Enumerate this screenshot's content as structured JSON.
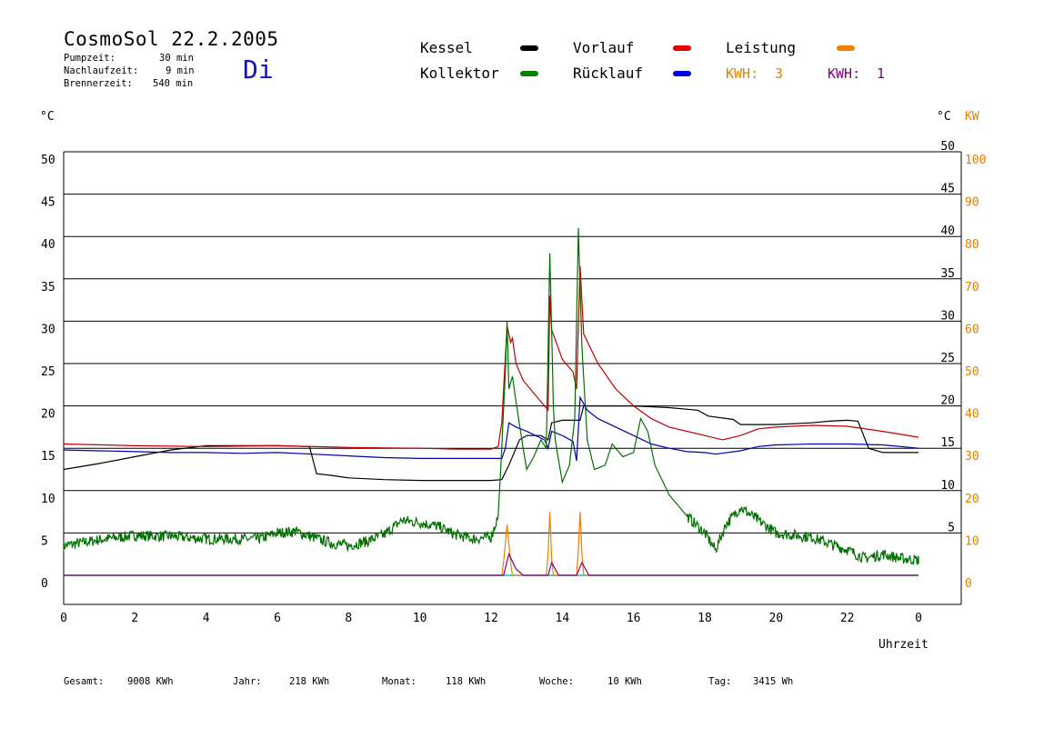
{
  "header": {
    "title": "CosmoSol 22.2.2005",
    "day": "Di",
    "info": [
      {
        "label": "Pumpzeit:",
        "value": "30 min"
      },
      {
        "label": "Nachlaufzeit:",
        "value": "9 min"
      },
      {
        "label": "Brennerzeit:",
        "value": "540 min"
      }
    ]
  },
  "legend": {
    "kessel": {
      "label": "Kessel",
      "color": "#000000"
    },
    "kollektor": {
      "label": "Kollektor",
      "color": "#008000"
    },
    "vorlauf": {
      "label": "Vorlauf",
      "color": "#e00000"
    },
    "ruecklauf": {
      "label": "Rücklauf",
      "color": "#0000e0"
    },
    "leistung": {
      "label": "Leistung",
      "color": "#f08000"
    },
    "kwh1": {
      "label": "KWH:",
      "value": "3",
      "color": "#e08000"
    },
    "kwh2": {
      "label": "KWH:",
      "value": "1",
      "color": "#800080"
    }
  },
  "footer": [
    {
      "label": "Gesamt:",
      "value": "9008 KWh"
    },
    {
      "label": "Jahr:",
      "value": "218 KWh"
    },
    {
      "label": "Monat:",
      "value": "118 KWh"
    },
    {
      "label": "Woche:",
      "value": "10 KWh"
    },
    {
      "label": "Tag:",
      "value": "3415 Wh"
    }
  ],
  "chart_data": {
    "type": "line",
    "xlabel": "Uhrzeit",
    "x_ticks": [
      "0",
      "2",
      "4",
      "6",
      "8",
      "10",
      "12",
      "14",
      "16",
      "18",
      "20",
      "22",
      "0"
    ],
    "xlim": [
      0,
      24
    ],
    "y_left": {
      "unit": "°C",
      "range": [
        0,
        50
      ],
      "ticks": [
        "0",
        "5",
        "10",
        "15",
        "20",
        "25",
        "30",
        "35",
        "40",
        "45",
        "50"
      ]
    },
    "y_right_temp": {
      "unit": "°C",
      "range": [
        0,
        50
      ],
      "ticks": [
        "5",
        "10",
        "15",
        "20",
        "25",
        "30",
        "35",
        "40",
        "45",
        "50"
      ]
    },
    "y_right_power": {
      "unit": "KW",
      "range": [
        0,
        100
      ],
      "ticks": [
        "0",
        "10",
        "20",
        "30",
        "40",
        "50",
        "60",
        "70",
        "80",
        "90",
        "100"
      ]
    },
    "grid": true,
    "series": [
      {
        "name": "Kessel",
        "key": "kessel",
        "axis": "temp",
        "color": "#000000",
        "points": [
          [
            0,
            12.5
          ],
          [
            1,
            13.2
          ],
          [
            2,
            14.0
          ],
          [
            3,
            14.8
          ],
          [
            4,
            15.3
          ],
          [
            5,
            15.3
          ],
          [
            6,
            15.3
          ],
          [
            6.9,
            15.2
          ],
          [
            7.1,
            12.0
          ],
          [
            7.5,
            11.8
          ],
          [
            8,
            11.5
          ],
          [
            9,
            11.3
          ],
          [
            10,
            11.2
          ],
          [
            11,
            11.2
          ],
          [
            12,
            11.2
          ],
          [
            12.3,
            11.3
          ],
          [
            12.5,
            13.0
          ],
          [
            12.8,
            16.0
          ],
          [
            13.0,
            16.5
          ],
          [
            13.4,
            16.5
          ],
          [
            13.6,
            16.0
          ],
          [
            13.7,
            18.0
          ],
          [
            14.0,
            18.3
          ],
          [
            14.5,
            18.3
          ],
          [
            14.6,
            20.0
          ],
          [
            15,
            20.0
          ],
          [
            16,
            20.0
          ],
          [
            17,
            19.8
          ],
          [
            17.8,
            19.5
          ],
          [
            18.1,
            18.8
          ],
          [
            18.8,
            18.4
          ],
          [
            19,
            17.8
          ],
          [
            20,
            17.8
          ],
          [
            21,
            18.0
          ],
          [
            21.5,
            18.2
          ],
          [
            22,
            18.3
          ],
          [
            22.3,
            18.2
          ],
          [
            22.6,
            15.0
          ],
          [
            23,
            14.5
          ],
          [
            24,
            14.5
          ]
        ]
      },
      {
        "name": "Vorlauf",
        "key": "vorlauf",
        "axis": "temp",
        "color": "#c00000",
        "points": [
          [
            0,
            15.5
          ],
          [
            2,
            15.3
          ],
          [
            4,
            15.2
          ],
          [
            6,
            15.3
          ],
          [
            8,
            15.1
          ],
          [
            10,
            15.0
          ],
          [
            11,
            14.9
          ],
          [
            12,
            14.9
          ],
          [
            12.2,
            15.2
          ],
          [
            12.3,
            18.0
          ],
          [
            12.45,
            29.5
          ],
          [
            12.55,
            27.5
          ],
          [
            12.6,
            28.0
          ],
          [
            12.7,
            25.0
          ],
          [
            12.9,
            23.0
          ],
          [
            13.2,
            21.5
          ],
          [
            13.6,
            19.5
          ],
          [
            13.65,
            33.0
          ],
          [
            13.7,
            29.0
          ],
          [
            14.0,
            25.5
          ],
          [
            14.3,
            24.0
          ],
          [
            14.4,
            22.0
          ],
          [
            14.5,
            36.5
          ],
          [
            14.6,
            28.5
          ],
          [
            15,
            25.0
          ],
          [
            15.5,
            22.0
          ],
          [
            16,
            20.0
          ],
          [
            16.5,
            18.5
          ],
          [
            17,
            17.5
          ],
          [
            18,
            16.5
          ],
          [
            18.5,
            16.0
          ],
          [
            19,
            16.5
          ],
          [
            19.5,
            17.3
          ],
          [
            20,
            17.5
          ],
          [
            21,
            17.7
          ],
          [
            22,
            17.6
          ],
          [
            23,
            17.0
          ],
          [
            24,
            16.3
          ]
        ]
      },
      {
        "name": "Rücklauf",
        "key": "ruecklauf",
        "axis": "temp",
        "color": "#0000b0",
        "points": [
          [
            0,
            14.8
          ],
          [
            1,
            14.7
          ],
          [
            2,
            14.6
          ],
          [
            3,
            14.5
          ],
          [
            4,
            14.5
          ],
          [
            5,
            14.4
          ],
          [
            6,
            14.5
          ],
          [
            7,
            14.3
          ],
          [
            8,
            14.1
          ],
          [
            9,
            13.9
          ],
          [
            10,
            13.8
          ],
          [
            11,
            13.8
          ],
          [
            12,
            13.8
          ],
          [
            12.3,
            13.8
          ],
          [
            12.4,
            15.0
          ],
          [
            12.5,
            18.0
          ],
          [
            12.7,
            17.5
          ],
          [
            13,
            17.0
          ],
          [
            13.5,
            16.0
          ],
          [
            13.6,
            15.0
          ],
          [
            13.7,
            17.0
          ],
          [
            14,
            16.5
          ],
          [
            14.3,
            15.8
          ],
          [
            14.4,
            13.5
          ],
          [
            14.5,
            21.0
          ],
          [
            14.7,
            19.5
          ],
          [
            15,
            18.5
          ],
          [
            15.5,
            17.5
          ],
          [
            16,
            16.5
          ],
          [
            16.5,
            15.5
          ],
          [
            17,
            15.0
          ],
          [
            17.5,
            14.6
          ],
          [
            18,
            14.5
          ],
          [
            18.3,
            14.3
          ],
          [
            19,
            14.7
          ],
          [
            19.5,
            15.2
          ],
          [
            20,
            15.4
          ],
          [
            21,
            15.5
          ],
          [
            22,
            15.5
          ],
          [
            23,
            15.4
          ],
          [
            24,
            15.0
          ]
        ]
      },
      {
        "name": "Kollektor",
        "key": "kollektor",
        "axis": "temp",
        "color": "#007000",
        "points": [
          [
            0,
            3.5
          ],
          [
            1,
            4.2
          ],
          [
            2,
            4.7
          ],
          [
            3,
            4.6
          ],
          [
            4,
            4.3
          ],
          [
            5,
            4.3
          ],
          [
            5.5,
            4.3
          ],
          [
            6,
            5.0
          ],
          [
            6.5,
            5.2
          ],
          [
            7,
            4.5
          ],
          [
            7.5,
            3.8
          ],
          [
            8,
            3.5
          ],
          [
            8.5,
            4.0
          ],
          [
            9,
            4.8
          ],
          [
            9.5,
            6.5
          ],
          [
            10,
            6.2
          ],
          [
            10.5,
            5.8
          ],
          [
            11,
            4.8
          ],
          [
            11.5,
            4.3
          ],
          [
            12,
            4.5
          ],
          [
            12.2,
            7.0
          ],
          [
            12.3,
            15.0
          ],
          [
            12.4,
            24.0
          ],
          [
            12.45,
            30.0
          ],
          [
            12.5,
            22.0
          ],
          [
            12.6,
            23.5
          ],
          [
            12.7,
            20.5
          ],
          [
            12.9,
            15.0
          ],
          [
            13.0,
            12.5
          ],
          [
            13.2,
            14.0
          ],
          [
            13.4,
            16.0
          ],
          [
            13.55,
            15.0
          ],
          [
            13.65,
            38.0
          ],
          [
            13.75,
            20.0
          ],
          [
            13.8,
            16.0
          ],
          [
            14.0,
            11.0
          ],
          [
            14.2,
            13.0
          ],
          [
            14.35,
            18.5
          ],
          [
            14.45,
            41.0
          ],
          [
            14.55,
            27.0
          ],
          [
            14.7,
            16.0
          ],
          [
            14.9,
            12.5
          ],
          [
            15.2,
            13.0
          ],
          [
            15.4,
            15.5
          ],
          [
            15.7,
            14.0
          ],
          [
            16,
            14.5
          ],
          [
            16.2,
            18.5
          ],
          [
            16.4,
            17.0
          ],
          [
            16.6,
            13.0
          ],
          [
            17,
            9.5
          ],
          [
            17.5,
            7.0
          ],
          [
            18,
            5.0
          ],
          [
            18.3,
            3.0
          ],
          [
            18.6,
            6.0
          ],
          [
            19,
            8.0
          ],
          [
            19.5,
            6.5
          ],
          [
            20,
            5.0
          ],
          [
            21,
            4.5
          ],
          [
            22,
            3.0
          ],
          [
            22.5,
            2.0
          ],
          [
            23,
            2.5
          ],
          [
            23.5,
            2.0
          ],
          [
            24,
            1.8
          ]
        ]
      },
      {
        "name": "Leistung",
        "key": "leistung",
        "axis": "power",
        "color": "#f08000",
        "points": [
          [
            0,
            0
          ],
          [
            12.3,
            0
          ],
          [
            12.35,
            3
          ],
          [
            12.45,
            12
          ],
          [
            12.55,
            3
          ],
          [
            12.6,
            0
          ],
          [
            13.55,
            0
          ],
          [
            13.6,
            5
          ],
          [
            13.65,
            15
          ],
          [
            13.7,
            4
          ],
          [
            13.75,
            0
          ],
          [
            14.4,
            0
          ],
          [
            14.45,
            6
          ],
          [
            14.5,
            15
          ],
          [
            14.55,
            5
          ],
          [
            14.6,
            0
          ],
          [
            24,
            0
          ]
        ]
      },
      {
        "name": "KWH 1",
        "key": "kwh2",
        "axis": "power",
        "color": "#800080",
        "points": [
          [
            0,
            0
          ],
          [
            12.35,
            0
          ],
          [
            12.5,
            5
          ],
          [
            12.7,
            1.5
          ],
          [
            12.9,
            0
          ],
          [
            13.6,
            0
          ],
          [
            13.7,
            3
          ],
          [
            13.9,
            0
          ],
          [
            14.4,
            0
          ],
          [
            14.55,
            3
          ],
          [
            14.75,
            0
          ],
          [
            24,
            0
          ]
        ]
      }
    ]
  }
}
